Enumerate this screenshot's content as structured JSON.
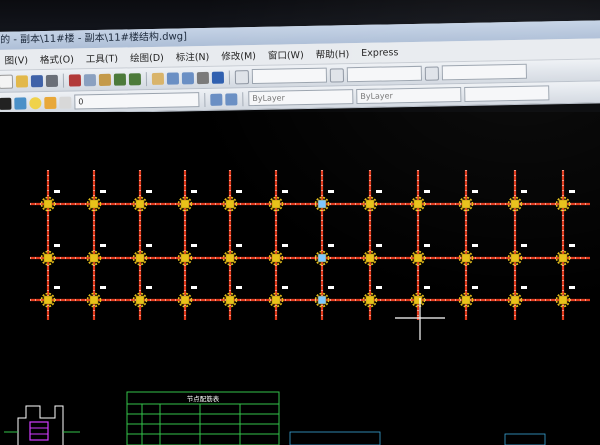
{
  "window": {
    "title": "的 - 副本\\11#楼 - 副本\\11#楼结构.dwg]"
  },
  "menu": {
    "items": [
      "图(V)",
      "格式(O)",
      "工具(T)",
      "绘图(D)",
      "标注(N)",
      "修改(M)",
      "窗口(W)",
      "帮助(H)",
      "Express"
    ]
  },
  "toolbar": {
    "layer_combo_value": "ByLayer",
    "linetype_combo_value": "ByLayer",
    "layer_name_value": "0"
  },
  "colors": {
    "background": "#000000",
    "column": "#e8c21a",
    "column_highlight": "#7fc8ff",
    "beam": "#e23a1c",
    "beam_dots": "#ffffff",
    "table_lines": "#33c24a",
    "crosshair": "#ffffff"
  },
  "drawing": {
    "axis_count": 12,
    "row_count": 3,
    "highlighted_axis_index": 6,
    "table_title": "节点配筋表"
  },
  "icons": [
    "new-icon",
    "open-icon",
    "save-icon",
    "print-icon",
    "cut-icon",
    "copy-icon",
    "paste-icon",
    "undo-icon",
    "redo-icon",
    "pan-icon",
    "zoom-icon",
    "properties-icon",
    "help-icon",
    "text-style-icon",
    "dim-style-icon",
    "layer-icon",
    "bulb-icon",
    "sun-icon",
    "lock-icon"
  ]
}
